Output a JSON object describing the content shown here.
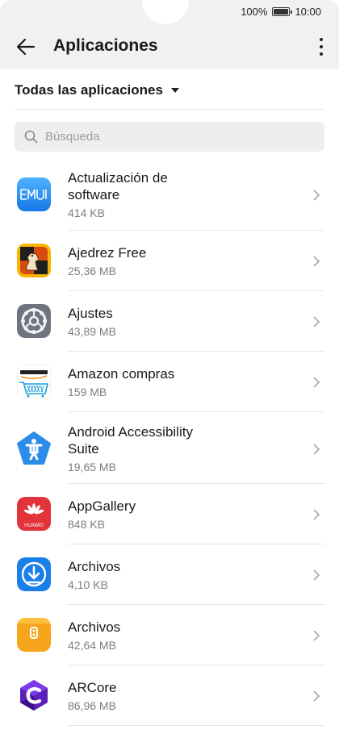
{
  "status": {
    "battery": "100%",
    "time": "10:00",
    "battery_level": 1.0
  },
  "appbar": {
    "title": "Aplicaciones"
  },
  "filter": {
    "label": "Todas las aplicaciones"
  },
  "search": {
    "placeholder": "Búsqueda",
    "value": ""
  },
  "apps": [
    {
      "name_line1": "Actualización de",
      "name_line2": "software",
      "size": "414 KB",
      "icon": "emui-icon"
    },
    {
      "name_line1": "Ajedrez Free",
      "name_line2": "",
      "size": "25,36 MB",
      "icon": "chess-icon"
    },
    {
      "name_line1": "Ajustes",
      "name_line2": "",
      "size": "43,89 MB",
      "icon": "settings-gear-icon"
    },
    {
      "name_line1": "Amazon compras",
      "name_line2": "",
      "size": "159 MB",
      "icon": "amazon-cart-icon"
    },
    {
      "name_line1": "Android Accessibility",
      "name_line2": "Suite",
      "size": "19,65 MB",
      "icon": "accessibility-icon"
    },
    {
      "name_line1": "AppGallery",
      "name_line2": "",
      "size": "848 KB",
      "icon": "appgallery-icon",
      "icon_label": "HUAWEI"
    },
    {
      "name_line1": "Archivos",
      "name_line2": "",
      "size": "4,10 KB",
      "icon": "download-files-icon"
    },
    {
      "name_line1": "Archivos",
      "name_line2": "",
      "size": "42,64 MB",
      "icon": "files-folder-icon"
    },
    {
      "name_line1": "ARCore",
      "name_line2": "",
      "size": "86,96 MB",
      "icon": "arcore-icon"
    }
  ]
}
